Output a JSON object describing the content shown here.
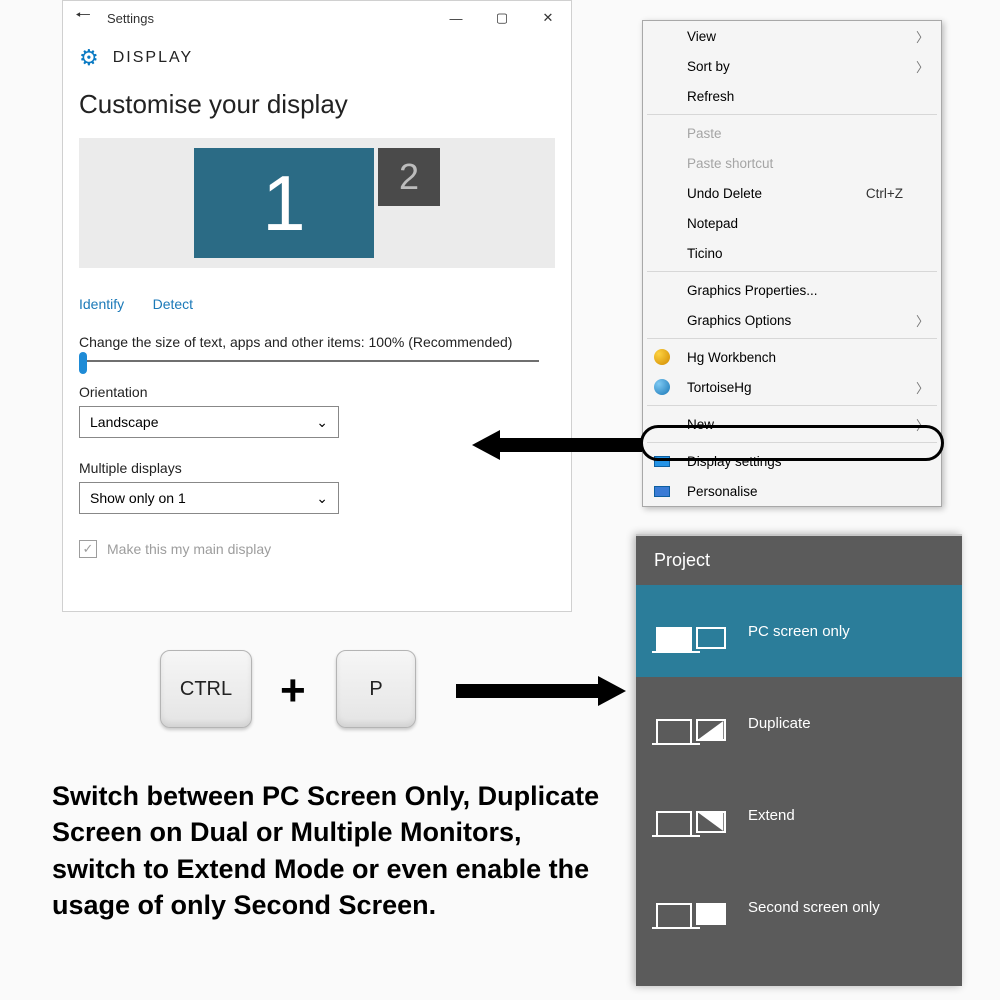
{
  "settings": {
    "title": "Settings",
    "header": "DISPLAY",
    "customise": "Customise your display",
    "monitor1": "1",
    "monitor2": "2",
    "identify": "Identify",
    "detect": "Detect",
    "scale_label": "Change the size of text, apps and other items: 100% (Recommended)",
    "orientation_label": "Orientation",
    "orientation_value": "Landscape",
    "multiple_label": "Multiple displays",
    "multiple_value": "Show only on 1",
    "main_display": "Make this my main display"
  },
  "context": {
    "view": "View",
    "sortby": "Sort by",
    "refresh": "Refresh",
    "paste": "Paste",
    "paste_shortcut": "Paste shortcut",
    "undo_delete": "Undo Delete",
    "undo_delete_key": "Ctrl+Z",
    "notepad": "Notepad",
    "ticino": "Ticino",
    "graphics_props": "Graphics Properties...",
    "graphics_opts": "Graphics Options",
    "hg_workbench": "Hg Workbench",
    "tortoisehg": "TortoiseHg",
    "new": "New",
    "display_settings": "Display settings",
    "personalise": "Personalise"
  },
  "keys": {
    "ctrl": "CTRL",
    "plus": "+",
    "p": "P"
  },
  "project": {
    "title": "Project",
    "pc_only": "PC screen only",
    "duplicate": "Duplicate",
    "extend": "Extend",
    "second_only": "Second screen only"
  },
  "caption": "Switch between PC Screen Only, Duplicate Screen on Dual or Multiple Monitors, switch to Extend Mode or even enable the usage of only Second Screen."
}
